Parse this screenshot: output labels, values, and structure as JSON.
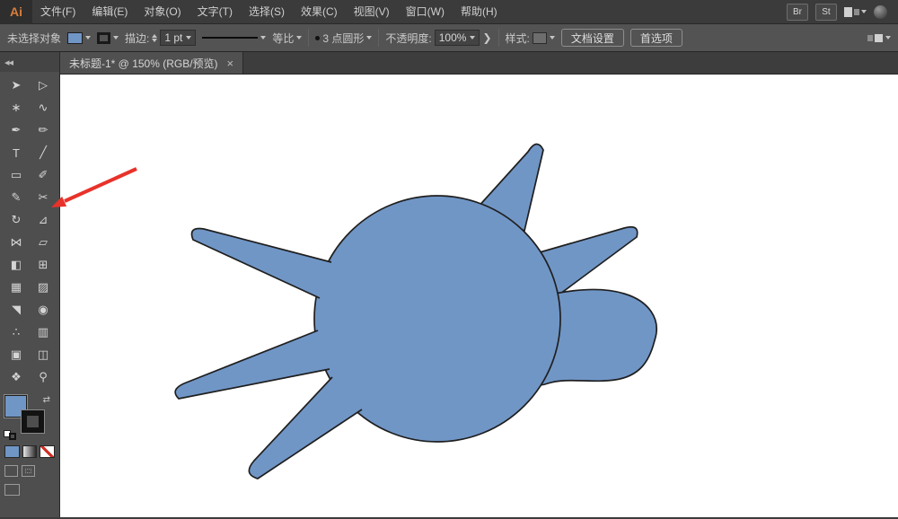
{
  "menubar": {
    "logo": "Ai",
    "items": [
      "文件(F)",
      "编辑(E)",
      "对象(O)",
      "文字(T)",
      "选择(S)",
      "效果(C)",
      "视图(V)",
      "窗口(W)",
      "帮助(H)"
    ],
    "br_button": "Br",
    "st_button": "St"
  },
  "controlbar": {
    "no_selection": "未选择对象",
    "stroke_label": "描边:",
    "stroke_value": "1 pt",
    "profile_value": "等比",
    "brush_value": "3 点圆形",
    "opacity_label": "不透明度:",
    "opacity_value": "100%",
    "more_chevron": "❯",
    "style_label": "样式:",
    "doc_setup_button": "文档设置",
    "preferences_button": "首选项"
  },
  "tabbar": {
    "tab_title": "未标题-1* @ 150% (RGB/预览)",
    "close": "×"
  },
  "toolbar": {
    "collapse": "◂◂",
    "tools": [
      {
        "name": "selection",
        "glyph": "➤"
      },
      {
        "name": "direct-selection",
        "glyph": "▷"
      },
      {
        "name": "magic-wand",
        "glyph": "∗"
      },
      {
        "name": "lasso",
        "glyph": "∿"
      },
      {
        "name": "pen",
        "glyph": "✒"
      },
      {
        "name": "curvature",
        "glyph": "✏"
      },
      {
        "name": "type",
        "glyph": "T"
      },
      {
        "name": "line-segment",
        "glyph": "╱"
      },
      {
        "name": "rectangle",
        "glyph": "▭"
      },
      {
        "name": "paintbrush",
        "glyph": "✐"
      },
      {
        "name": "pencil",
        "glyph": "✎"
      },
      {
        "name": "scissors",
        "glyph": "✂"
      },
      {
        "name": "rotate",
        "glyph": "↻"
      },
      {
        "name": "scale",
        "glyph": "⊿"
      },
      {
        "name": "width",
        "glyph": "⋈"
      },
      {
        "name": "free-transform",
        "glyph": "▱"
      },
      {
        "name": "shape-builder",
        "glyph": "◧"
      },
      {
        "name": "perspective-grid",
        "glyph": "⊞"
      },
      {
        "name": "mesh",
        "glyph": "▦"
      },
      {
        "name": "gradient",
        "glyph": "▨"
      },
      {
        "name": "eyedropper",
        "glyph": "◥"
      },
      {
        "name": "blend",
        "glyph": "◉"
      },
      {
        "name": "symbol-sprayer",
        "glyph": "∴"
      },
      {
        "name": "column-graph",
        "glyph": "▥"
      },
      {
        "name": "artboard",
        "glyph": "▣"
      },
      {
        "name": "slice",
        "glyph": "◫"
      },
      {
        "name": "hand",
        "glyph": "❖"
      },
      {
        "name": "zoom",
        "glyph": "⚲"
      }
    ],
    "swap_icon": "⇄"
  },
  "artwork": {
    "description": "blue circle with five tapered spikes and a right-side blob appendage, black outline",
    "zoom_level": "150%",
    "color_mode": "RGB/预览"
  },
  "colors": {
    "artwork_fill": "#7096c6",
    "artwork_stroke": "#1f1f1f",
    "annotation_red": "#e8322a",
    "fill_swatch": "#7096c6"
  }
}
